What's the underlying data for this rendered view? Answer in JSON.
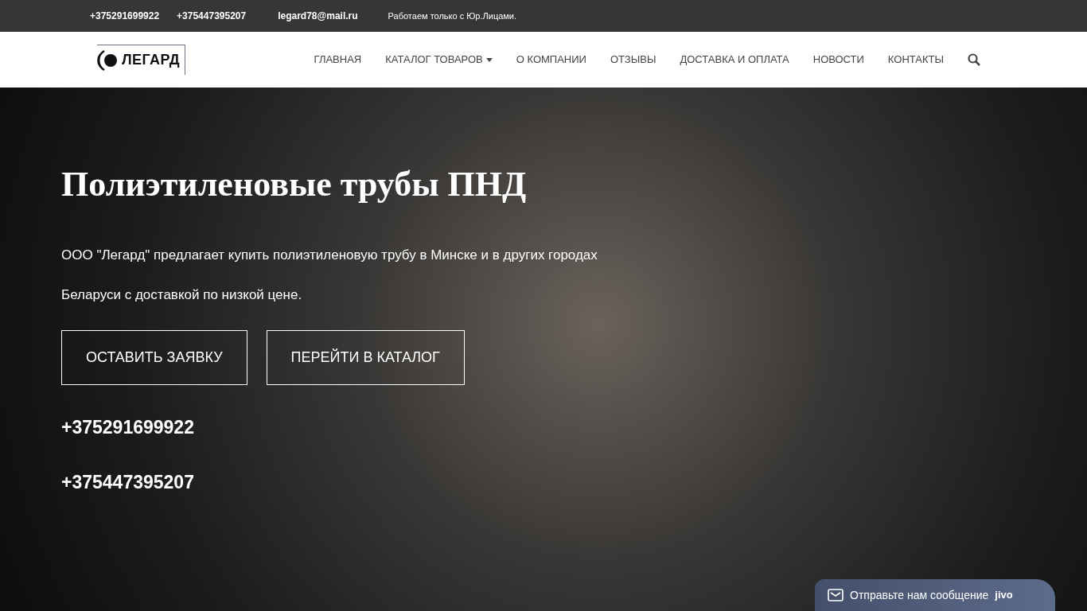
{
  "top_bar": {
    "phones": [
      "+375291699922",
      "+375447395207"
    ],
    "email": "legard78@mail.ru",
    "note": "Работаем только с Юр.Лицами."
  },
  "header": {
    "logo_text": "ЛЕГАРД",
    "nav": [
      {
        "label": "ГЛАВНАЯ",
        "dropdown": false
      },
      {
        "label": "КАТАЛОГ ТОВАРОВ",
        "dropdown": true
      },
      {
        "label": "О КОМПАНИИ",
        "dropdown": false
      },
      {
        "label": "ОТЗЫВЫ",
        "dropdown": false
      },
      {
        "label": "ДОСТАВКА И ОПЛАТА",
        "dropdown": false
      },
      {
        "label": "НОВОСТИ",
        "dropdown": false
      },
      {
        "label": "КОНТАКТЫ",
        "dropdown": false
      }
    ]
  },
  "hero": {
    "title": "Полиэтиленовые трубы ПНД",
    "text_lines": [
      "ООО \"Легард\" предлагает купить полиэтиленовую трубу в Минске и в других городах",
      "Беларуси с доставкой по низкой цене."
    ],
    "buttons": [
      "ОСТАВИТЬ ЗАЯВКУ",
      "ПЕРЕЙТИ В КАТАЛОГ"
    ],
    "phones": [
      "+375291699922",
      "+375447395207"
    ]
  },
  "chat_widget": {
    "label": "Отправьте нам сообщение",
    "brand": "jivo"
  }
}
